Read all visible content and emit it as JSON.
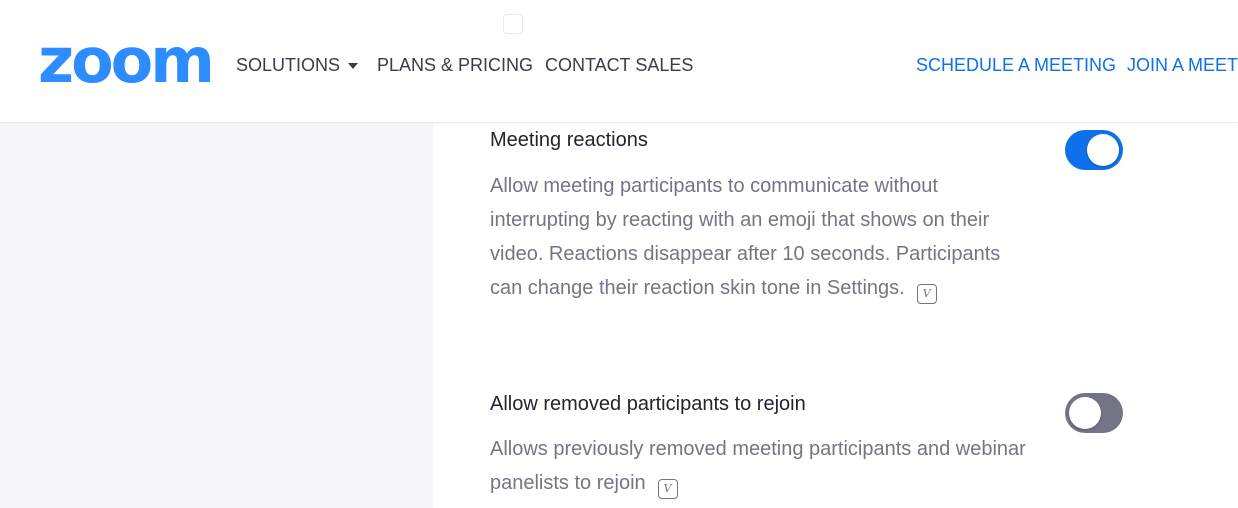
{
  "header": {
    "logo_text": "zoom",
    "nav": {
      "solutions": "SOLUTIONS",
      "plans": "PLANS & PRICING",
      "contact": "CONTACT SALES",
      "schedule": "SCHEDULE A MEETING",
      "join": "JOIN A MEETI"
    }
  },
  "settings": [
    {
      "title": "Meeting reactions",
      "description": "Allow meeting participants to communicate without interrupting by reacting with an emoji that shows on their video. Reactions disappear after 10 seconds. Participants can change their reaction skin tone in Settings.",
      "enabled": true,
      "info_icon": "version-info-icon"
    },
    {
      "title": "Allow removed participants to rejoin",
      "description": "Allows previously removed meeting participants and webinar panelists to rejoin",
      "enabled": false,
      "info_icon": "version-info-icon"
    }
  ],
  "colors": {
    "brand": "#2d8cff",
    "accent": "#0e71eb",
    "toggle_off": "#747487",
    "sidebar": "#f5f5f8"
  }
}
